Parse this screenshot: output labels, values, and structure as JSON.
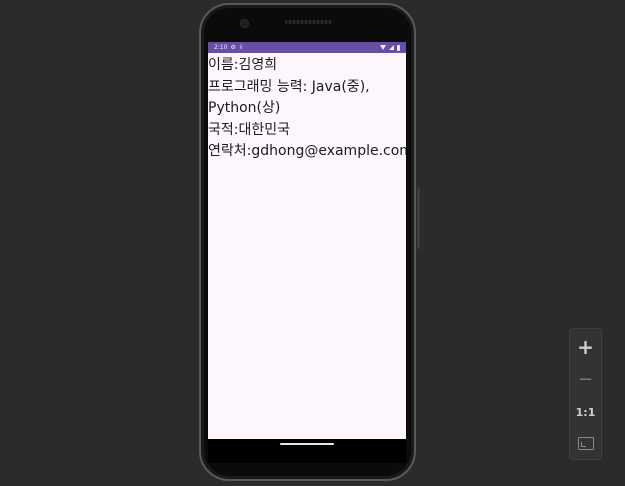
{
  "status_bar": {
    "time": "2:10",
    "icons": [
      "gear-icon",
      "download-icon",
      "wifi-icon",
      "signal-icon",
      "battery-icon"
    ]
  },
  "profile": {
    "name_line": "이름:김영희",
    "skills_line": "프로그래밍 능력: Java(중), Python(상)",
    "nationality_line": "국적:대한민국",
    "contact_line": "연락처:gdhong@example.com"
  },
  "zoom_controls": {
    "zoom_in": "+",
    "zoom_out": "−",
    "actual_size": "1:1"
  },
  "colors": {
    "status_bar": "#6750a4",
    "screen_background": "#fdf7fd",
    "desktop_background": "#2b2b2b"
  }
}
